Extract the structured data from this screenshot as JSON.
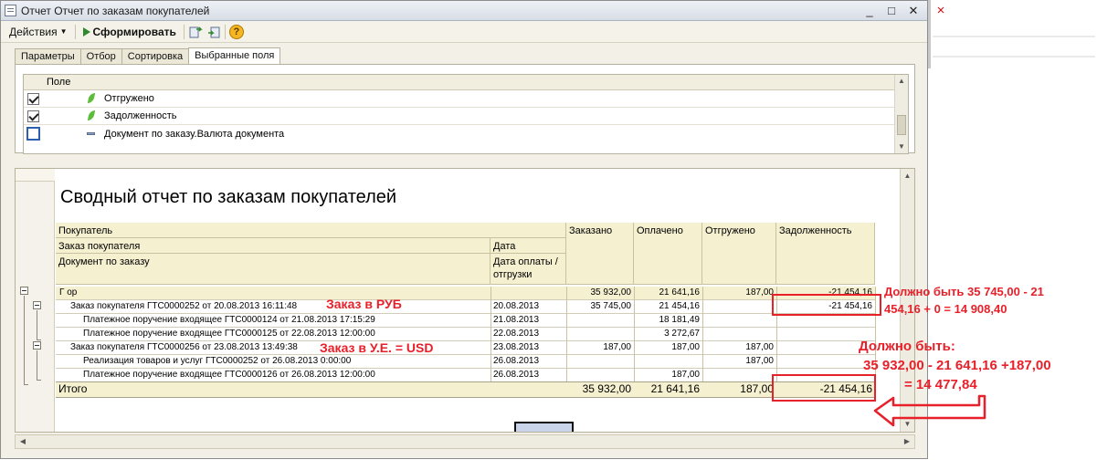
{
  "window": {
    "title": "Отчет  Отчет по заказам покупателей",
    "min": "_",
    "max": "□",
    "close": "✕"
  },
  "toolbar": {
    "actions_label": "Действия",
    "generate_label": "Сформировать",
    "help_label": "?"
  },
  "tabs": [
    {
      "label": "Параметры"
    },
    {
      "label": "Отбор"
    },
    {
      "label": "Сортировка"
    },
    {
      "label": "Выбранные поля"
    }
  ],
  "fields": {
    "header": "Поле",
    "rows": [
      {
        "label": "Отгружено",
        "checked": true
      },
      {
        "label": "Задолженность",
        "checked": true
      },
      {
        "label": "Документ по заказу.Валюта документа",
        "checked": false
      }
    ]
  },
  "report": {
    "title": "Сводный отчет по заказам покупателей",
    "headers": {
      "buyer": "Покупатель",
      "order": "Заказ покупателя",
      "doc": "Документ по заказу",
      "date": "Дата",
      "pay_date": "Дата оплаты /отгрузки",
      "ordered": "Заказано",
      "paid": "Оплачено",
      "shipped": "Отгружено",
      "debt": "Задолженность"
    },
    "rows": [
      {
        "name": "Г            ор",
        "date": "",
        "ordered": "35 932,00",
        "paid": "21 641,16",
        "shipped": "187,00",
        "debt": "-21 454,16"
      },
      {
        "name": "Заказ покупателя ГТС0000252 от 20.08.2013 16:11:48",
        "date": "20.08.2013",
        "ordered": "35 745,00",
        "paid": "21 454,16",
        "shipped": "",
        "debt": "-21 454,16"
      },
      {
        "name": "Платежное поручение входящее ГТС0000124 от 21.08.2013 17:15:29",
        "date": "21.08.2013",
        "ordered": "",
        "paid": "18 181,49",
        "shipped": "",
        "debt": ""
      },
      {
        "name": "Платежное поручение входящее ГТС0000125 от 22.08.2013 12:00:00",
        "date": "22.08.2013",
        "ordered": "",
        "paid": "3 272,67",
        "shipped": "",
        "debt": ""
      },
      {
        "name": "Заказ покупателя ГТС0000256 от 23.08.2013 13:49:38",
        "date": "23.08.2013",
        "ordered": "187,00",
        "paid": "187,00",
        "shipped": "187,00",
        "debt": ""
      },
      {
        "name": "Реализация товаров и услуг ГТС0000252 от 26.08.2013 0:00:00",
        "date": "26.08.2013",
        "ordered": "",
        "paid": "",
        "shipped": "187,00",
        "debt": ""
      },
      {
        "name": "Платежное поручение входящее ГТС0000126 от 26.08.2013 12:00:00",
        "date": "26.08.2013",
        "ordered": "",
        "paid": "187,00",
        "shipped": "",
        "debt": ""
      }
    ],
    "total": {
      "label": "Итого",
      "ordered": "35 932,00",
      "paid": "21 641,16",
      "shipped": "187,00",
      "debt": "-21 454,16"
    }
  },
  "annotations": {
    "rub": "Заказ в РУБ",
    "usd": "Заказ в У.Е. = USD",
    "note1_line1": "Должно быть   35 745,00 - 21",
    "note1_line2": "454,16 + 0 = 14 908,40",
    "note2_line1": "Должно быть:",
    "note2_line2": "35 932,00 - 21 641,16 +187,00",
    "note2_line3": "= 14 477,84",
    "color": "#e8202a"
  }
}
